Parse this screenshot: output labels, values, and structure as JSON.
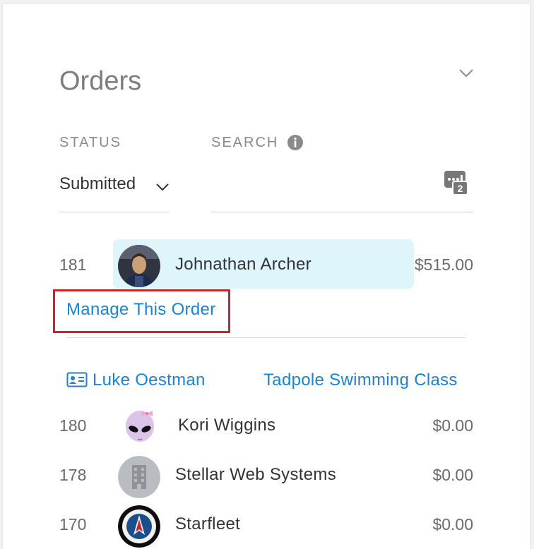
{
  "panel": {
    "title": "Orders"
  },
  "filters": {
    "status_label": "STATUS",
    "status_value": "Submitted",
    "search_label": "SEARCH",
    "search_value": ""
  },
  "selected_order": {
    "number": "181",
    "customer": "Johnathan Archer",
    "amount": "$515.00",
    "manage_link": "Manage This Order",
    "contact_name": "Luke Oestman",
    "item_name": "Tadpole Swimming Class"
  },
  "orders": [
    {
      "number": "180",
      "customer": "Kori Wiggins",
      "amount": "$0.00",
      "avatar": "alien-avatar"
    },
    {
      "number": "178",
      "customer": "Stellar Web Systems",
      "amount": "$0.00",
      "avatar": "building-avatar"
    },
    {
      "number": "170",
      "customer": "Starfleet",
      "amount": "$0.00",
      "avatar": "starfleet-logo-avatar"
    }
  ],
  "colors": {
    "link": "#1a84d2",
    "highlight": "#def5fb",
    "annotation_box": "#c0282d"
  }
}
